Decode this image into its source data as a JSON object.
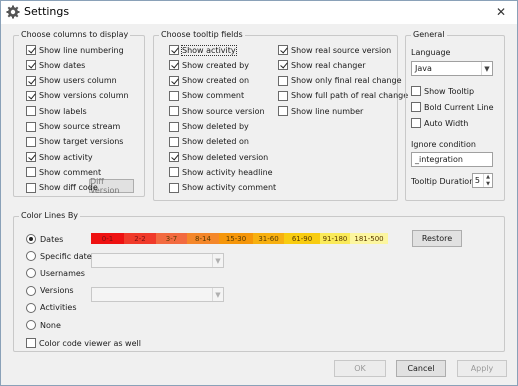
{
  "window": {
    "title": "Settings",
    "close_glyph": "✕"
  },
  "columns_group": {
    "title": "Choose columns to display",
    "items": [
      {
        "label": "Show line numbering",
        "checked": true
      },
      {
        "label": "Show dates",
        "checked": true
      },
      {
        "label": "Show users column",
        "checked": true
      },
      {
        "label": "Show versions column",
        "checked": true
      },
      {
        "label": "Show labels",
        "checked": false
      },
      {
        "label": "Show source stream",
        "checked": false
      },
      {
        "label": "Show target versions",
        "checked": false
      },
      {
        "label": "Show activity",
        "checked": true
      },
      {
        "label": "Show comment",
        "checked": false
      },
      {
        "label": "Show diff code",
        "checked": false
      }
    ],
    "diff_version_button": "Diff Version"
  },
  "tooltip_group": {
    "title": "Choose tooltip fields",
    "left_items": [
      {
        "label": "Show activity",
        "checked": true
      },
      {
        "label": "Show created by",
        "checked": true
      },
      {
        "label": "Show created on",
        "checked": true
      },
      {
        "label": "Show comment",
        "checked": false
      },
      {
        "label": "Show source version",
        "checked": false
      },
      {
        "label": "Show deleted by",
        "checked": false
      },
      {
        "label": "Show deleted on",
        "checked": false
      },
      {
        "label": "Show deleted version",
        "checked": true
      },
      {
        "label": "Show activity headline",
        "checked": false
      },
      {
        "label": "Show activity comment",
        "checked": false
      }
    ],
    "right_items": [
      {
        "label": "Show real source version",
        "checked": true
      },
      {
        "label": "Show real changer",
        "checked": true
      },
      {
        "label": "Show only final real change",
        "checked": false
      },
      {
        "label": "Show full path of real change",
        "checked": false
      },
      {
        "label": "Show line number",
        "checked": false
      }
    ]
  },
  "general_group": {
    "title": "General",
    "language_label": "Language",
    "language_value": "Java",
    "show_tooltip": {
      "label": "Show Tooltip",
      "checked": false
    },
    "bold_current_line": {
      "label": "Bold Current Line",
      "checked": false
    },
    "auto_width": {
      "label": "Auto Width",
      "checked": false
    },
    "ignore_label": "Ignore condition",
    "ignore_value": "_integration",
    "tooltip_duration_label": "Tooltip Duration",
    "tooltip_duration_value": "5"
  },
  "color_group": {
    "title": "Color Lines By",
    "options": [
      {
        "label": "Dates",
        "selected": true
      },
      {
        "label": "Specific date",
        "selected": false
      },
      {
        "label": "Usernames",
        "selected": false
      },
      {
        "label": "Versions",
        "selected": false
      },
      {
        "label": "Activities",
        "selected": false
      },
      {
        "label": "None",
        "selected": false
      }
    ],
    "legend": [
      {
        "label": "0-1",
        "color": "#ee1111"
      },
      {
        "label": "2-2",
        "color": "#f03a2a"
      },
      {
        "label": "3-7",
        "color": "#f26a40"
      },
      {
        "label": "8-14",
        "color": "#f4872a"
      },
      {
        "label": "15-30",
        "color": "#f5960a"
      },
      {
        "label": "31-60",
        "color": "#f7b010"
      },
      {
        "label": "61-90",
        "color": "#f8cc10"
      },
      {
        "label": "91-180",
        "color": "#faea5a"
      },
      {
        "label": "181-500",
        "color": "#fcf6a0"
      }
    ],
    "restore_button": "Restore",
    "color_code_viewer": {
      "label": "Color code viewer as well",
      "checked": false
    }
  },
  "footer": {
    "ok": "OK",
    "cancel": "Cancel",
    "apply": "Apply"
  }
}
